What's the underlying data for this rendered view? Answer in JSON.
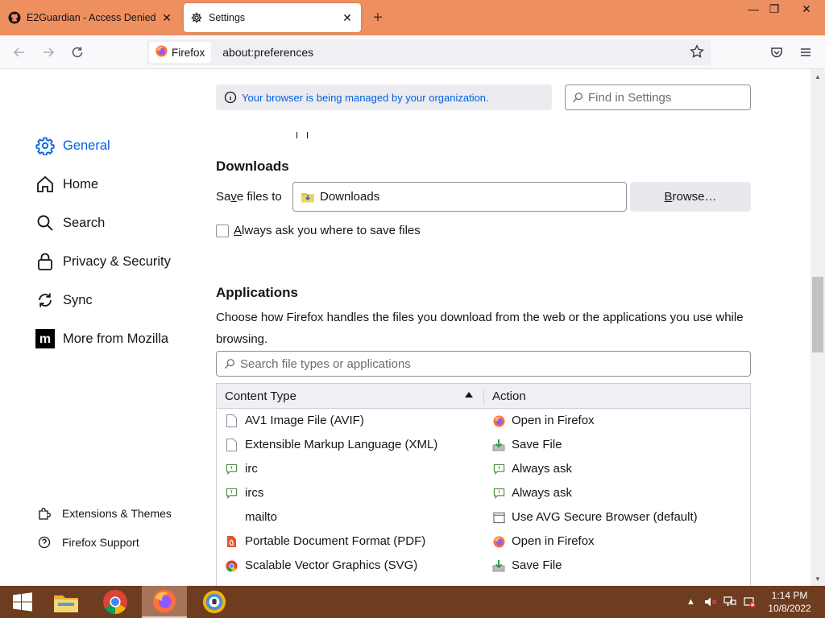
{
  "window": {
    "tabs": [
      {
        "label": "E2Guardian - Access Denied",
        "icon": "github-icon",
        "active": false
      },
      {
        "label": "Settings",
        "icon": "gear-icon",
        "active": true
      }
    ],
    "new_tab_symbol": "+",
    "controls": {
      "minimize": "—",
      "restore": "❐",
      "close": "✕"
    }
  },
  "navbar": {
    "identity_label": "Firefox",
    "url": "about:preferences"
  },
  "policy_notice": "Your browser is being managed by your organization.",
  "find_placeholder": "Find in Settings",
  "sidebar": {
    "items": [
      {
        "label": "General",
        "icon": "gear-icon",
        "selected": true
      },
      {
        "label": "Home",
        "icon": "home-icon",
        "selected": false
      },
      {
        "label": "Search",
        "icon": "search-icon",
        "selected": false
      },
      {
        "label": "Privacy & Security",
        "icon": "lock-icon",
        "selected": false
      },
      {
        "label": "Sync",
        "icon": "sync-icon",
        "selected": false
      },
      {
        "label": "More from Mozilla",
        "icon": "mozilla-icon",
        "selected": false
      }
    ],
    "footer": [
      {
        "label": "Extensions & Themes",
        "icon": "puzzle-icon"
      },
      {
        "label": "Firefox Support",
        "icon": "help-icon"
      }
    ]
  },
  "downloads": {
    "heading": "Downloads",
    "save_files_pre": "Sa",
    "save_files_ul": "v",
    "save_files_post": "e files to",
    "folder": "Downloads",
    "browse_ul": "B",
    "browse_post": "rowse…",
    "always_ask_ul": "A",
    "always_ask_post": "lways ask you where to save files",
    "always_ask_checked": false
  },
  "applications": {
    "heading": "Applications",
    "description": "Choose how Firefox handles the files you download from the web or the applications you use while browsing.",
    "search_placeholder": "Search file types or applications",
    "col_content_type": "Content Type",
    "col_action": "Action",
    "rows": [
      {
        "type": "AV1 Image File (AVIF)",
        "type_icon": "document-icon",
        "action": "Open in Firefox",
        "action_icon": "firefox-icon"
      },
      {
        "type": "Extensible Markup Language (XML)",
        "type_icon": "document-icon",
        "action": "Save File",
        "action_icon": "save-file-icon"
      },
      {
        "type": "irc",
        "type_icon": "chat-icon",
        "action": "Always ask",
        "action_icon": "ask-icon"
      },
      {
        "type": "ircs",
        "type_icon": "chat-icon",
        "action": "Always ask",
        "action_icon": "ask-icon"
      },
      {
        "type": "mailto",
        "type_icon": "",
        "action": "Use AVG Secure Browser (default)",
        "action_icon": "app-icon"
      },
      {
        "type": "Portable Document Format (PDF)",
        "type_icon": "pdf-icon",
        "action": "Open in Firefox",
        "action_icon": "firefox-icon"
      },
      {
        "type": "Scalable Vector Graphics (SVG)",
        "type_icon": "chrome-icon",
        "action": "Save File",
        "action_icon": "save-file-icon"
      }
    ]
  },
  "taskbar": {
    "apps": [
      "start-icon",
      "file-explorer-icon",
      "chrome-icon",
      "firefox-icon",
      "avg-browser-icon"
    ],
    "time": "1:14 PM",
    "date": "10/8/2022"
  },
  "colors": {
    "titlebar": "#ee8f60",
    "accent": "#0061e0",
    "taskbar": "#6e3c1f"
  }
}
